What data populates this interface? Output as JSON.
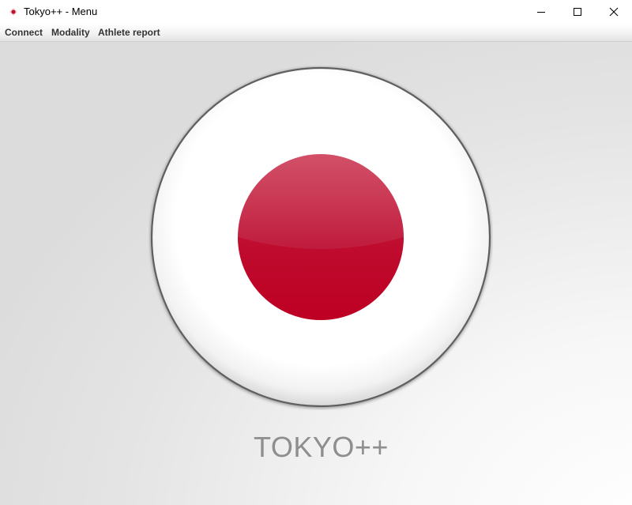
{
  "window": {
    "title": "Tokyo++ - Menu",
    "controls": [
      "minimize-icon",
      "maximize-icon",
      "close-icon"
    ]
  },
  "menu": {
    "items": [
      {
        "label": "Connect"
      },
      {
        "label": "Modality"
      },
      {
        "label": "Athlete report"
      }
    ]
  },
  "main": {
    "brand": "TOKYO++"
  },
  "colors": {
    "flag_red": "#bf0025",
    "brand_gray": "#8e8e8e",
    "rim": "#5e5e5e"
  }
}
